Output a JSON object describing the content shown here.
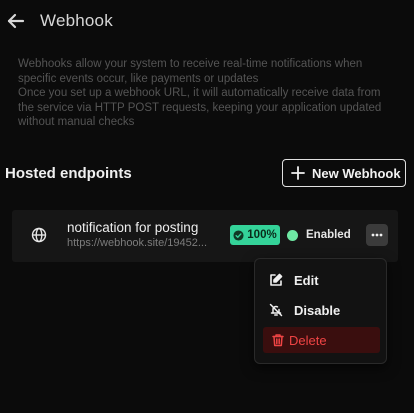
{
  "header": {
    "title": "Webhook"
  },
  "description": {
    "line1": "Webhooks allow your system to receive real-time notifications when",
    "line2": "specific events occur, like payments or updates",
    "line3": "Once you set up a webhook URL, it will automatically receive data from",
    "line4": "the service via HTTP POST requests, keeping your application updated",
    "line5": "without manual checks"
  },
  "section": {
    "title": "Hosted endpoints",
    "new_button_label": "New Webhook"
  },
  "endpoint": {
    "name": "notification for posting",
    "url": "https://webhook.site/19452...",
    "success_rate": "100%",
    "status": "Enabled",
    "status_color": "#6ee7a3",
    "badge_color": "#34d399"
  },
  "menu": {
    "edit": "Edit",
    "disable": "Disable",
    "delete": "Delete",
    "delete_color": "#ef4444"
  }
}
